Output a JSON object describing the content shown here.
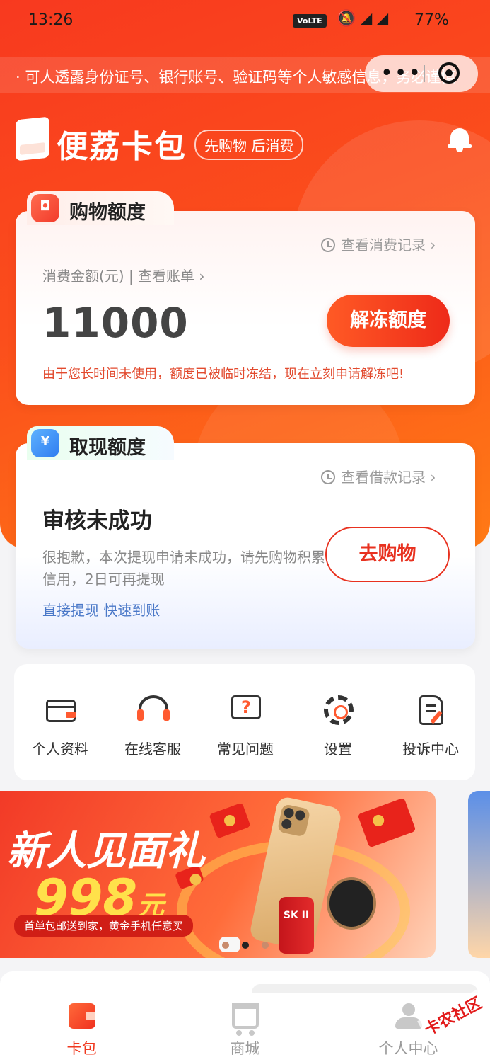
{
  "status_bar": {
    "time": "13:26",
    "volte": "VoLTE",
    "battery": "77%"
  },
  "ticker": {
    "text": "· 可人透露身份证号、银行账号、验证码等个人敏感信息，务必谨慎"
  },
  "header": {
    "app_name": "便荔卡包",
    "slogan": "先购物 后消费"
  },
  "shopping_card": {
    "tab_label": "购物额度",
    "history_link": "查看消费记录 ›",
    "amount_label": "消费金额(元)  |  查看账单 ›",
    "amount": "11000",
    "button": "解冻额度",
    "notice": "由于您长时间未使用，额度已被临时冻结，现在立刻申请解冻吧!"
  },
  "cash_card": {
    "tab_label": "取现额度",
    "tab_icon": "¥",
    "history_link": "查看借款记录 ›",
    "status_title": "审核未成功",
    "description": "很抱歉，本次提现申请未成功，请先购物积累信用，2日可再提现",
    "link": "直接提现 快速到账",
    "button": "去购物"
  },
  "quick_menu": [
    {
      "label": "个人资料",
      "icon": "id-card-icon"
    },
    {
      "label": "在线客服",
      "icon": "headset-icon"
    },
    {
      "label": "常见问题",
      "icon": "question-icon"
    },
    {
      "label": "设置",
      "icon": "gear-icon"
    },
    {
      "label": "投诉中心",
      "icon": "complaint-doc-icon"
    }
  ],
  "banner": {
    "headline": "新人见面礼",
    "amount": "998",
    "unit": "元",
    "subline": "首单包邮送到家，黄金手机任意买",
    "product_label": "SK II",
    "slide_index": 2,
    "slide_count": 3
  },
  "bottom_nav": [
    {
      "label": "卡包",
      "icon": "wallet-icon",
      "active": true
    },
    {
      "label": "商城",
      "icon": "cart-icon",
      "active": false
    },
    {
      "label": "个人中心",
      "icon": "user-icon",
      "active": false
    }
  ],
  "watermark": "卡农社区",
  "colors": {
    "primary": "#f0391f",
    "accent": "#ff7a15",
    "link": "#4a78c8"
  }
}
